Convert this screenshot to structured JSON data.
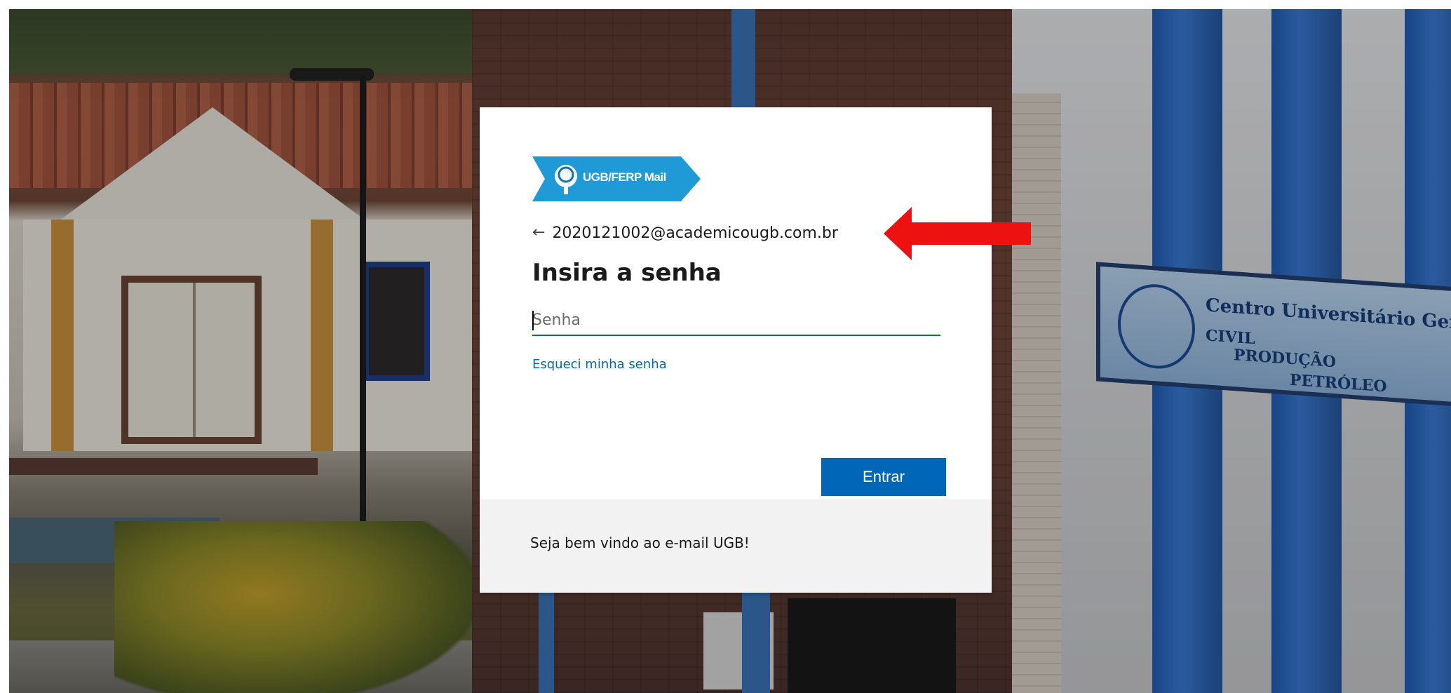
{
  "login": {
    "brand": "UGB/FERP Mail",
    "identity": "2020121002@academicougb.com.br",
    "back_icon": "back-arrow-icon",
    "title": "Insira a senha",
    "password_placeholder": "Senha",
    "forgot_link": "Esqueci minha senha",
    "submit_label": "Entrar",
    "footer_text": "Seja bem vindo ao e-mail UGB!"
  },
  "background": {
    "sign_line1": "Centro Universitário Geraldo Di Bi",
    "sign_line2": "CIVIL",
    "sign_line3": "PRODUÇÃO",
    "sign_line4": "PETRÓLEO"
  },
  "colors": {
    "accent": "#0067b8",
    "brand_banner": "#1f9ad6",
    "annotation_arrow": "#ee1111",
    "footer_bg": "#f2f2f2"
  }
}
